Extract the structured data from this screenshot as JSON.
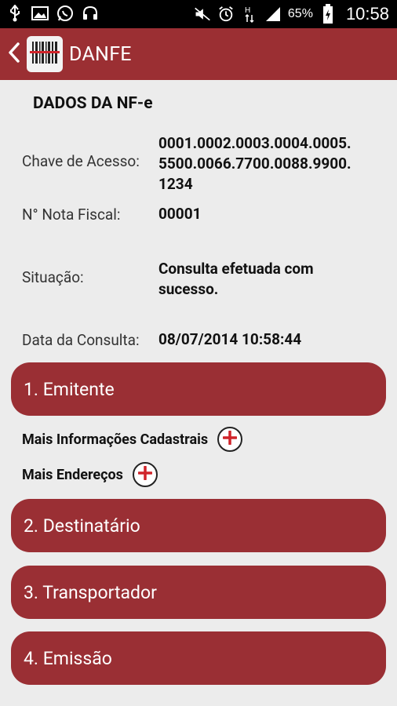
{
  "status_bar": {
    "battery_percent": "65%",
    "time": "10:58",
    "left_icons": [
      "usb-icon",
      "image-icon",
      "whatsapp-icon",
      "headset-icon"
    ],
    "right_icons": [
      "mute-icon",
      "alarm-icon",
      "hspa-icon",
      "signal-icon",
      "battery-icon"
    ]
  },
  "app_bar": {
    "title": "DANFE",
    "back_icon": "chevron-left-icon",
    "logo_icon": "barcode-icon",
    "color": "#9b2f33"
  },
  "nfe": {
    "section_title": "DADOS DA NF-e",
    "fields": [
      {
        "label": "Chave de Acesso:",
        "value_lines": [
          "0001.0002.0003.0004.0005.",
          "5500.0066.7700.0088.9900.",
          "1234"
        ]
      },
      {
        "label": "N° Nota Fiscal:",
        "value": "00001"
      },
      {
        "label": "Situação:",
        "value_lines": [
          "Consulta efetuada com",
          "sucesso."
        ]
      },
      {
        "label": "Data da Consulta:",
        "value": "08/07/2014 10:58:44"
      }
    ]
  },
  "sections": [
    {
      "label": "1. Emitente"
    },
    {
      "label": "2. Destinatário"
    },
    {
      "label": "3. Transportador"
    },
    {
      "label": "4. Emissão"
    }
  ],
  "more": [
    {
      "label": "Mais Informações Cadastrais",
      "icon": "plus-circle-icon"
    },
    {
      "label": "Mais Endereços",
      "icon": "plus-circle-icon"
    }
  ],
  "colors": {
    "accent": "#9a2f34",
    "plus_red": "#d0242a",
    "background": "#ececec"
  }
}
